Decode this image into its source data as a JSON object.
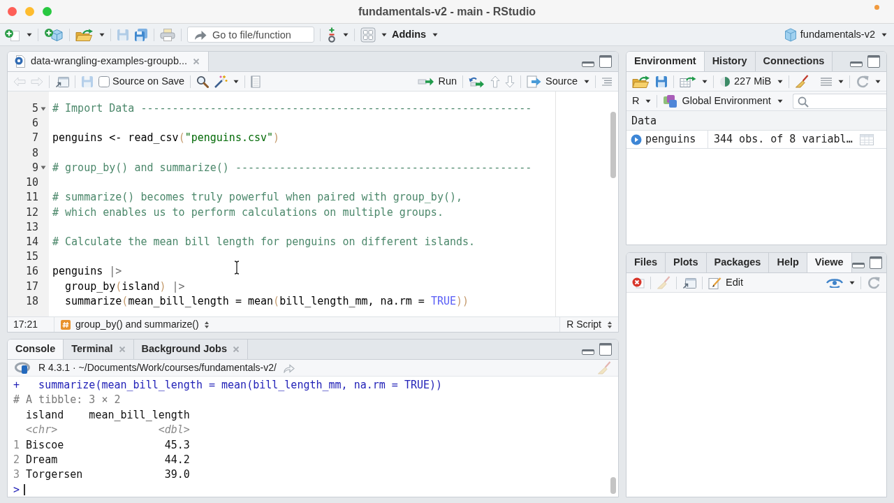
{
  "window": {
    "title": "fundamentals-v2 - main - RStudio"
  },
  "toolbar": {
    "groups": [
      [
        {
          "kind": "new-file",
          "dropdown": true,
          "disabled": false
        }
      ],
      [
        {
          "kind": "new-project",
          "disabled": false
        }
      ],
      [
        {
          "kind": "open",
          "dropdown": true,
          "disabled": false
        }
      ],
      [
        {
          "kind": "save",
          "disabled": true
        },
        {
          "kind": "save-all",
          "disabled": false
        }
      ],
      [
        {
          "kind": "print",
          "disabled": false
        }
      ],
      [
        {
          "kind": "goto",
          "placeholder": "Go to file/function"
        }
      ],
      [
        {
          "kind": "vcs",
          "dropdown": true,
          "disabled": false
        }
      ],
      [
        {
          "kind": "layout",
          "dropdown": true,
          "disabled": false
        },
        {
          "kind": "addins",
          "label": "Addins",
          "dropdown": true,
          "disabled": false
        }
      ]
    ],
    "right": [
      [
        {
          "kind": "project",
          "label": "fundamentals-v2",
          "dropdown": true,
          "disabled": false
        }
      ]
    ]
  },
  "source": {
    "tabs": [
      {
        "kind": "r-script",
        "label": "data-wrangling-examples-groupb...",
        "selected": true,
        "closable": true
      }
    ],
    "toolbar": {
      "groups": [
        [
          {
            "kind": "back",
            "disabled": true
          },
          {
            "kind": "forward",
            "disabled": true
          }
        ],
        [
          {
            "kind": "popout",
            "disabled": false
          }
        ],
        [
          {
            "kind": "save",
            "disabled": true
          },
          {
            "kind": "checkbox",
            "label": "Source on Save",
            "checked": false
          }
        ],
        [
          {
            "kind": "find",
            "disabled": false
          },
          {
            "kind": "wand",
            "dropdown": true,
            "disabled": false
          }
        ],
        [
          {
            "kind": "notebook",
            "disabled": false
          }
        ]
      ],
      "right": [
        [
          {
            "kind": "run",
            "label": "Run",
            "disabled": false
          }
        ],
        [
          {
            "kind": "rerun",
            "disabled": false
          },
          {
            "kind": "up",
            "disabled": false
          },
          {
            "kind": "down",
            "disabled": false
          }
        ],
        [
          {
            "kind": "source",
            "label": "Source",
            "dropdown": true,
            "disabled": false
          }
        ],
        [
          {
            "kind": "outline",
            "disabled": false
          }
        ]
      ]
    },
    "lines": [
      {
        "number": "5",
        "foldable": true,
        "segments": [
          {
            "kind": "comment",
            "text": "# Import Data --------------------------------------------------------------"
          }
        ]
      },
      {
        "number": "6"
      },
      {
        "number": "7",
        "segments": [
          {
            "kind": "code",
            "text": "penguins <- read_csv"
          },
          {
            "kind": "paren",
            "text": "("
          },
          {
            "kind": "string",
            "text": "\"penguins.csv\""
          },
          {
            "kind": "paren",
            "text": ")"
          }
        ]
      },
      {
        "number": "8"
      },
      {
        "number": "9",
        "foldable": true,
        "segments": [
          {
            "kind": "comment",
            "text": "# group_by() and summarize() -----------------------------------------------"
          }
        ]
      },
      {
        "number": "10"
      },
      {
        "number": "11",
        "segments": [
          {
            "kind": "comment",
            "text": "# summarize() becomes truly powerful when paired with group_by(),"
          }
        ]
      },
      {
        "number": "12",
        "segments": [
          {
            "kind": "comment",
            "text": "# which enables us to perform calculations on multiple groups."
          }
        ]
      },
      {
        "number": "13"
      },
      {
        "number": "14",
        "segments": [
          {
            "kind": "comment",
            "text": "# Calculate the mean bill length for penguins on different islands."
          }
        ]
      },
      {
        "number": "15"
      },
      {
        "number": "16",
        "segments": [
          {
            "kind": "code",
            "text": "penguins"
          },
          {
            "kind": "pipe",
            "text": " |>"
          }
        ]
      },
      {
        "number": "17",
        "segments": [
          {
            "kind": "code",
            "text": "  group_by"
          },
          {
            "kind": "paren",
            "text": "("
          },
          {
            "kind": "code",
            "text": "island"
          },
          {
            "kind": "paren",
            "text": ")"
          },
          {
            "kind": "pipe",
            "text": " |>"
          }
        ]
      },
      {
        "number": "18",
        "segments": [
          {
            "kind": "code",
            "text": "  summarize"
          },
          {
            "kind": "paren",
            "text": "("
          },
          {
            "kind": "code",
            "text": "mean_bill_length = mean"
          },
          {
            "kind": "paren",
            "text": "("
          },
          {
            "kind": "code",
            "text": "bill_length_mm, na.rm = "
          },
          {
            "kind": "constant",
            "text": "TRUE"
          },
          {
            "kind": "paren",
            "text": "))"
          }
        ]
      }
    ],
    "status": {
      "position": "17:21",
      "section": "group_by() and summarize()",
      "filetype": "R Script"
    }
  },
  "console": {
    "tabs": [
      {
        "label": "Console",
        "selected": true
      },
      {
        "label": "Terminal",
        "selected": false,
        "closable": true
      },
      {
        "label": "Background Jobs",
        "selected": false,
        "closable": true
      }
    ],
    "path": "R 4.3.1 · ~/Documents/Work/courses/fundamentals-v2/",
    "clear": {
      "disabled": true
    },
    "lines": [
      {
        "segments": [
          {
            "kind": "input",
            "text": "+   summarize(mean_bill_length = mean(bill_length_mm, na.rm = TRUE))"
          }
        ]
      },
      {
        "segments": [
          {
            "kind": "meta",
            "text": "# A tibble: 3 × 2"
          }
        ]
      },
      {
        "segments": [
          {
            "kind": "output",
            "text": "  island    mean_bill_length"
          }
        ]
      },
      {
        "segments": [
          {
            "kind": "type",
            "text": "  <chr>                <dbl>"
          }
        ]
      },
      {
        "segments": [
          {
            "kind": "index",
            "text": "1"
          },
          {
            "kind": "output",
            "text": " Biscoe                45.3"
          }
        ]
      },
      {
        "segments": [
          {
            "kind": "index",
            "text": "2"
          },
          {
            "kind": "output",
            "text": " Dream                 44.2"
          }
        ]
      },
      {
        "segments": [
          {
            "kind": "index",
            "text": "3"
          },
          {
            "kind": "output",
            "text": " Torgersen             39.0"
          }
        ]
      },
      {
        "segments": [
          {
            "kind": "prompt",
            "text": ">"
          }
        ]
      }
    ]
  },
  "environment": {
    "tabs": [
      {
        "label": "Environment",
        "selected": true
      },
      {
        "label": "History",
        "selected": false
      },
      {
        "label": "Connections",
        "selected": false
      }
    ],
    "toolbar": {
      "groups": [
        [
          {
            "kind": "open",
            "disabled": false
          },
          {
            "kind": "save",
            "disabled": false
          }
        ],
        [
          {
            "kind": "import",
            "dropdown": true,
            "disabled": false
          }
        ],
        [
          {
            "kind": "memory",
            "label": "227 MiB",
            "dropdown": true,
            "disabled": false
          }
        ],
        [
          {
            "kind": "broom",
            "disabled": false
          }
        ]
      ],
      "right": [
        [
          {
            "kind": "list",
            "dropdown": true,
            "disabled": false
          }
        ],
        [
          {
            "kind": "refresh",
            "dropdown": true,
            "disabled": false
          }
        ]
      ]
    },
    "scope": {
      "groups": [
        [
          {
            "kind": "language",
            "label": "R",
            "dropdown": true,
            "disabled": false
          }
        ],
        [
          {
            "kind": "environment",
            "label": "Global Environment",
            "dropdown": true,
            "disabled": false
          }
        ]
      ],
      "right": [
        [
          {
            "kind": "search"
          }
        ]
      ]
    },
    "sections": [
      {
        "title": "Data",
        "rows": [
          {
            "name": "penguins",
            "value": "344 obs. of 8 variabl…",
            "expanded": false
          }
        ]
      }
    ]
  },
  "viewer": {
    "tabs": [
      {
        "label": "Files",
        "selected": false
      },
      {
        "label": "Plots",
        "selected": false
      },
      {
        "label": "Packages",
        "selected": false
      },
      {
        "label": "Help",
        "selected": false
      },
      {
        "label": "Viewe",
        "selected": true
      }
    ],
    "toolbar": {
      "groups": [
        [
          {
            "kind": "remove",
            "disabled": false
          }
        ],
        [
          {
            "kind": "broom",
            "disabled": true
          }
        ],
        [
          {
            "kind": "popout",
            "disabled": false
          }
        ],
        [
          {
            "kind": "edit",
            "label": "Edit",
            "disabled": false
          }
        ]
      ],
      "right": [
        [
          {
            "kind": "publish",
            "dropdown": true,
            "disabled": false
          }
        ],
        [
          {
            "kind": "refresh",
            "disabled": false
          }
        ]
      ]
    }
  }
}
